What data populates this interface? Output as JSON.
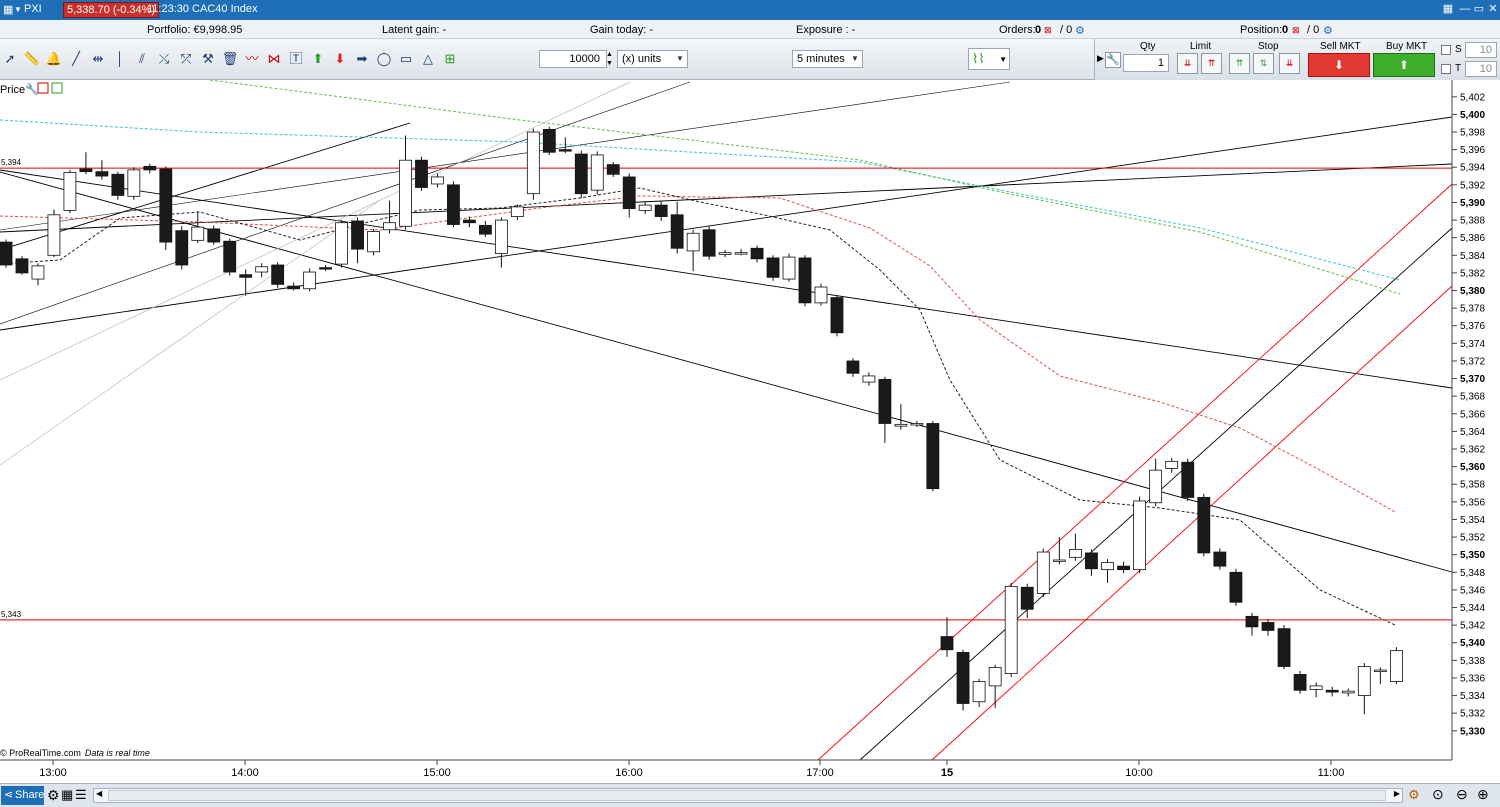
{
  "titlebar": {
    "menu_label": "PXI",
    "badge": "5,338.70 (-0.34%)",
    "time_instrument": "11:23:30 CAC40 Index",
    "win_buttons": [
      "▦",
      "—",
      "▭",
      "✕"
    ]
  },
  "portfolio_bar": {
    "portfolio": "Portfolio: €9,998.95",
    "latent_gain": "Latent gain: -",
    "gain_today": "Gain today: -",
    "exposure": "Exposure : -",
    "orders_label": "Orders:",
    "orders_a": "0",
    "orders_b": "/ 0",
    "position_label": "Position:",
    "position_a": "0",
    "position_b": "/ 0"
  },
  "toolbar": {
    "quantity": "10000",
    "units": "(x) units",
    "timeframe": "5 minutes"
  },
  "order_panel": {
    "qty_label": "Qty",
    "qty_value": "1",
    "limit_label": "Limit",
    "stop_label": "Stop",
    "sell_label": "Sell MKT",
    "buy_label": "Buy MKT",
    "s_label": "S",
    "s_value": "10",
    "t_label": "T",
    "t_value": "10"
  },
  "chart_header": {
    "price_label": "Price"
  },
  "statusbar": {
    "share_label": "Share"
  },
  "colors": {
    "titlebar": "#1f6fb8",
    "badge": "#c9302c",
    "sell": "#e23a33",
    "buy": "#3fae2a",
    "hline": "#e00000",
    "channel": "#ff0000"
  },
  "chart_data": {
    "type": "candlestick",
    "instrument": "CAC40 Index",
    "timeframe": "5 minutes",
    "ylim": [
      5328.5,
      5403
    ],
    "y_ticks": [
      "5,402",
      "5,400",
      "5,398",
      "5,396",
      "5,394",
      "5,392",
      "5,390",
      "5,388",
      "5,386",
      "5,384",
      "5,382",
      "5,380",
      "5,378",
      "5,376",
      "5,374",
      "5,372",
      "5,370",
      "5,368",
      "5,366",
      "5,364",
      "5,362",
      "5,360",
      "5,358",
      "5,356",
      "5,354",
      "5,352",
      "5,350",
      "5,348",
      "5,346",
      "5,344",
      "5,342",
      "5,340",
      "5,338",
      "5,336",
      "5,334",
      "5,332",
      "5,330"
    ],
    "y_ticks_bold": [
      "5,400",
      "5,390",
      "5,380",
      "5,370",
      "5,360",
      "5,350",
      "5,340",
      "5,330"
    ],
    "x_ticks": [
      "13:00",
      "14:00",
      "15:00",
      "16:00",
      "17:00",
      "15",
      "10:00",
      "11:00"
    ],
    "x_ticks_bold": [
      "15"
    ],
    "hlines": [
      {
        "label": "5,394",
        "value": 5393.9
      },
      {
        "label": "5,343",
        "value": 5342.6
      }
    ],
    "footer_source": "© ProRealTime.com",
    "footer_note": "Data is real time",
    "candles": [
      [
        5385.5,
        5382.9,
        5385.8,
        5382.6
      ],
      [
        5383.6,
        5382.0,
        5383.9,
        5381.8
      ],
      [
        5381.3,
        5382.8,
        5383.1,
        5380.6
      ],
      [
        5384.0,
        5388.6,
        5389.2,
        5383.8
      ],
      [
        5389.1,
        5393.4,
        5393.7,
        5388.8
      ],
      [
        5393.8,
        5393.5,
        5395.7,
        5393.2
      ],
      [
        5393.5,
        5393.0,
        5394.8,
        5392.6
      ],
      [
        5393.2,
        5390.8,
        5393.5,
        5390.3
      ],
      [
        5390.7,
        5393.7,
        5394.0,
        5390.3
      ],
      [
        5394.1,
        5393.7,
        5394.4,
        5393.3
      ],
      [
        5393.8,
        5385.5,
        5394.1,
        5384.6
      ],
      [
        5386.8,
        5382.9,
        5387.3,
        5382.4
      ],
      [
        5385.7,
        5387.2,
        5389.0,
        5385.4
      ],
      [
        5387.0,
        5385.5,
        5387.4,
        5385.2
      ],
      [
        5385.6,
        5382.1,
        5385.9,
        5381.7
      ],
      [
        5381.8,
        5381.5,
        5382.4,
        5379.4
      ],
      [
        5382.1,
        5382.7,
        5383.1,
        5381.5
      ],
      [
        5382.9,
        5380.7,
        5383.2,
        5380.3
      ],
      [
        5380.5,
        5380.2,
        5380.9,
        5380.0
      ],
      [
        5380.2,
        5382.1,
        5382.5,
        5379.9
      ],
      [
        5382.6,
        5382.5,
        5382.9,
        5382.2
      ],
      [
        5383.0,
        5387.7,
        5388.0,
        5382.6
      ],
      [
        5387.9,
        5384.7,
        5388.3,
        5383.1
      ],
      [
        5384.4,
        5386.7,
        5387.0,
        5384.0
      ],
      [
        5386.9,
        5387.7,
        5390.2,
        5386.5
      ],
      [
        5387.3,
        5394.8,
        5397.6,
        5386.9
      ],
      [
        5394.8,
        5391.7,
        5395.2,
        5391.3
      ],
      [
        5392.1,
        5392.9,
        5393.3,
        5391.7
      ],
      [
        5392.0,
        5387.5,
        5392.4,
        5387.2
      ],
      [
        5388.0,
        5387.7,
        5388.4,
        5387.2
      ],
      [
        5387.4,
        5386.4,
        5387.9,
        5386.1
      ],
      [
        5384.2,
        5388.0,
        5388.3,
        5382.6
      ],
      [
        5388.4,
        5389.5,
        5389.8,
        5388.0
      ],
      [
        5391.0,
        5398.0,
        5398.4,
        5390.3
      ],
      [
        5398.3,
        5395.7,
        5398.6,
        5395.4
      ],
      [
        5396.0,
        5395.9,
        5397.4,
        5395.6
      ],
      [
        5395.5,
        5391.0,
        5395.9,
        5390.5
      ],
      [
        5391.4,
        5395.4,
        5395.8,
        5390.9
      ],
      [
        5394.3,
        5393.2,
        5394.6,
        5392.9
      ],
      [
        5392.9,
        5389.3,
        5393.3,
        5388.3
      ],
      [
        5389.1,
        5389.7,
        5390.1,
        5388.7
      ],
      [
        5389.7,
        5388.4,
        5390.2,
        5387.9
      ],
      [
        5388.6,
        5384.8,
        5390.1,
        5384.2
      ],
      [
        5384.5,
        5386.5,
        5386.9,
        5382.2
      ],
      [
        5386.9,
        5383.9,
        5387.3,
        5383.5
      ],
      [
        5384.1,
        5384.3,
        5384.6,
        5383.8
      ],
      [
        5384.3,
        5384.3,
        5384.7,
        5384.0
      ],
      [
        5384.8,
        5383.6,
        5385.1,
        5383.2
      ],
      [
        5383.7,
        5381.5,
        5384.0,
        5381.1
      ],
      [
        5381.3,
        5383.8,
        5384.2,
        5381.0
      ],
      [
        5383.7,
        5378.6,
        5384.0,
        5378.2
      ],
      [
        5378.6,
        5380.4,
        5380.8,
        5378.3
      ],
      [
        5379.2,
        5375.2,
        5379.5,
        5374.8
      ],
      [
        5372.0,
        5370.6,
        5372.3,
        5370.2
      ],
      [
        5369.6,
        5370.3,
        5370.7,
        5369.2
      ],
      [
        5369.9,
        5364.9,
        5370.2,
        5362.7
      ],
      [
        5364.6,
        5364.8,
        5367.1,
        5364.2
      ],
      [
        5364.8,
        5364.9,
        5365.2,
        5364.5
      ],
      [
        5364.9,
        5357.5,
        5365.2,
        5357.2
      ],
      [
        5340.7,
        5339.2,
        5342.9,
        5338.4
      ],
      [
        5338.9,
        5333.1,
        5339.2,
        5332.3
      ],
      [
        5333.3,
        5335.6,
        5335.9,
        5332.7
      ],
      [
        5335.1,
        5337.2,
        5337.5,
        5332.6
      ],
      [
        5336.5,
        5346.4,
        5346.8,
        5336.1
      ],
      [
        5346.3,
        5343.8,
        5346.7,
        5342.8
      ],
      [
        5345.6,
        5350.3,
        5350.7,
        5345.2
      ],
      [
        5349.3,
        5349.4,
        5352.0,
        5348.9
      ],
      [
        5349.7,
        5350.6,
        5352.4,
        5349.3
      ],
      [
        5350.2,
        5348.4,
        5350.6,
        5347.6
      ],
      [
        5348.3,
        5349.1,
        5349.5,
        5346.8
      ],
      [
        5348.7,
        5348.3,
        5349.2,
        5347.9
      ],
      [
        5348.3,
        5356.1,
        5356.6,
        5347.9
      ],
      [
        5355.9,
        5359.6,
        5360.9,
        5355.5
      ],
      [
        5359.8,
        5360.6,
        5361.0,
        5359.3
      ],
      [
        5360.5,
        5356.5,
        5360.9,
        5356.1
      ],
      [
        5356.5,
        5350.2,
        5356.9,
        5349.8
      ],
      [
        5350.3,
        5348.7,
        5350.7,
        5348.3
      ],
      [
        5348.0,
        5344.6,
        5348.4,
        5344.2
      ],
      [
        5343.0,
        5341.8,
        5343.4,
        5340.8
      ],
      [
        5342.3,
        5341.4,
        5342.7,
        5340.8
      ],
      [
        5341.6,
        5337.3,
        5342.0,
        5337.0
      ],
      [
        5336.4,
        5334.6,
        5336.8,
        5334.2
      ],
      [
        5334.7,
        5335.1,
        5335.5,
        5333.8
      ],
      [
        5334.6,
        5334.4,
        5335.0,
        5333.9
      ],
      [
        5334.3,
        5334.5,
        5334.8,
        5333.9
      ],
      [
        5334.0,
        5337.3,
        5337.7,
        5331.9
      ],
      [
        5336.8,
        5336.9,
        5337.2,
        5335.3
      ],
      [
        5335.6,
        5339.1,
        5339.5,
        5335.3
      ]
    ],
    "candle_fields": [
      "open",
      "close",
      "high",
      "low"
    ]
  }
}
